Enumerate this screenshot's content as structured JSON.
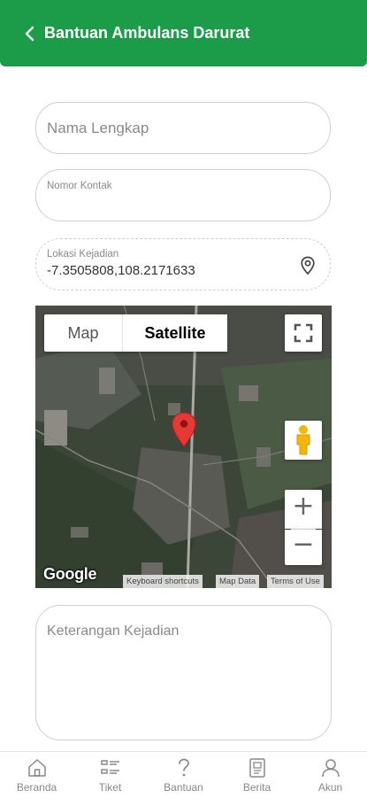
{
  "header": {
    "title": "Bantuan Ambulans Darurat"
  },
  "form": {
    "name_placeholder": "Nama Lengkap",
    "contact_label": "Nomor Kontak",
    "location_label": "Lokasi Kejadian",
    "location_value": "-7.3505808,108.2171633",
    "description_placeholder": "Keterangan Kejadian"
  },
  "map": {
    "type_map": "Map",
    "type_satellite": "Satellite",
    "selected_type": "Satellite",
    "logo": "Google",
    "attribution": [
      "Keyboard shortcuts",
      "Map Data",
      "Terms of Use"
    ],
    "zoom_in": "+",
    "zoom_out": "−"
  },
  "nav": {
    "items": [
      {
        "label": "Beranda",
        "icon": "home-icon"
      },
      {
        "label": "Tiket",
        "icon": "ticket-list-icon"
      },
      {
        "label": "Bantuan",
        "icon": "help-icon"
      },
      {
        "label": "Berita",
        "icon": "news-icon"
      },
      {
        "label": "Akun",
        "icon": "account-icon"
      }
    ]
  },
  "colors": {
    "primary": "#1c9b48",
    "pin": "#e53935"
  }
}
